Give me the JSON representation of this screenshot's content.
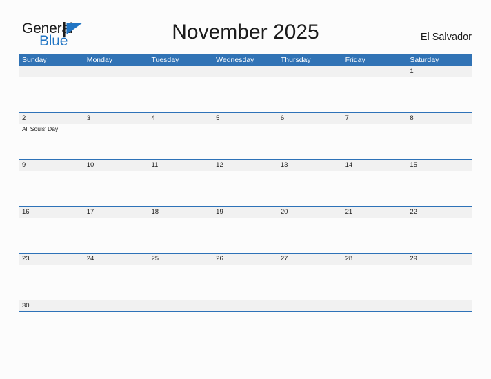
{
  "brand": {
    "name_part1": "General",
    "name_part2": "Blue",
    "flag_icon": "flag-triangle-icon",
    "accent_color": "#2175c4",
    "pole_color": "#1c1c1c"
  },
  "header": {
    "title": "November 2025",
    "locale": "El Salvador"
  },
  "colors": {
    "header_blue": "#3173b5",
    "divider_blue": "#2e72b8",
    "date_band_gray": "#f1f1f1",
    "page_background": "#fcfcfc",
    "text_dark": "#1c1c1c",
    "text_white": "#ffffff"
  },
  "calendar": {
    "weekdays": [
      "Sunday",
      "Monday",
      "Tuesday",
      "Wednesday",
      "Thursday",
      "Friday",
      "Saturday"
    ],
    "weeks": [
      {
        "days": [
          {
            "date": "",
            "events": []
          },
          {
            "date": "",
            "events": []
          },
          {
            "date": "",
            "events": []
          },
          {
            "date": "",
            "events": []
          },
          {
            "date": "",
            "events": []
          },
          {
            "date": "",
            "events": []
          },
          {
            "date": "1",
            "events": []
          }
        ]
      },
      {
        "days": [
          {
            "date": "2",
            "events": [
              "All Souls' Day"
            ]
          },
          {
            "date": "3",
            "events": []
          },
          {
            "date": "4",
            "events": []
          },
          {
            "date": "5",
            "events": []
          },
          {
            "date": "6",
            "events": []
          },
          {
            "date": "7",
            "events": []
          },
          {
            "date": "8",
            "events": []
          }
        ]
      },
      {
        "days": [
          {
            "date": "9",
            "events": []
          },
          {
            "date": "10",
            "events": []
          },
          {
            "date": "11",
            "events": []
          },
          {
            "date": "12",
            "events": []
          },
          {
            "date": "13",
            "events": []
          },
          {
            "date": "14",
            "events": []
          },
          {
            "date": "15",
            "events": []
          }
        ]
      },
      {
        "days": [
          {
            "date": "16",
            "events": []
          },
          {
            "date": "17",
            "events": []
          },
          {
            "date": "18",
            "events": []
          },
          {
            "date": "19",
            "events": []
          },
          {
            "date": "20",
            "events": []
          },
          {
            "date": "21",
            "events": []
          },
          {
            "date": "22",
            "events": []
          }
        ]
      },
      {
        "days": [
          {
            "date": "23",
            "events": []
          },
          {
            "date": "24",
            "events": []
          },
          {
            "date": "25",
            "events": []
          },
          {
            "date": "26",
            "events": []
          },
          {
            "date": "27",
            "events": []
          },
          {
            "date": "28",
            "events": []
          },
          {
            "date": "29",
            "events": []
          }
        ]
      },
      {
        "days": [
          {
            "date": "30",
            "events": []
          },
          {
            "date": "",
            "events": []
          },
          {
            "date": "",
            "events": []
          },
          {
            "date": "",
            "events": []
          },
          {
            "date": "",
            "events": []
          },
          {
            "date": "",
            "events": []
          },
          {
            "date": "",
            "events": []
          }
        ]
      }
    ]
  }
}
